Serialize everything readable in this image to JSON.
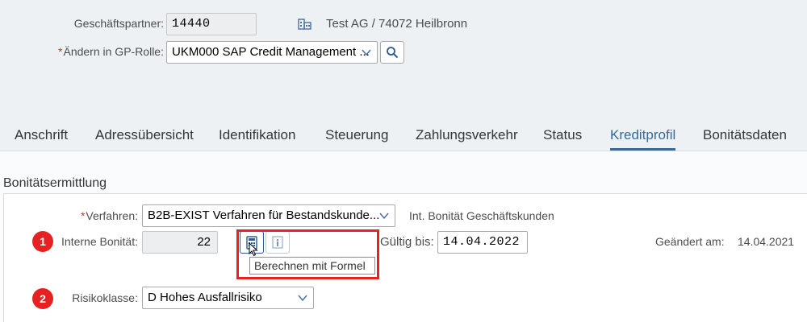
{
  "header": {
    "partner_label": "Geschäftspartner:",
    "partner_value": "14440",
    "partner_icon": "company-icon",
    "partner_name": "Test AG / 74072 Heilbronn",
    "role_required_mark": "*",
    "role_label": "Ändern in GP-Rolle:",
    "role_value": "UKM000 SAP Credit Management ...",
    "role_search_icon": "search-icon"
  },
  "tabs": [
    {
      "label": "Anschrift",
      "active": false
    },
    {
      "label": "Adressübersicht",
      "active": false
    },
    {
      "label": "Identifikation",
      "active": false
    },
    {
      "label": "Steuerung",
      "active": false
    },
    {
      "label": "Zahlungsverkehr",
      "active": false
    },
    {
      "label": "Status",
      "active": false
    },
    {
      "label": "Kreditprofil",
      "active": true
    },
    {
      "label": "Bonitätsdaten",
      "active": false
    }
  ],
  "section": {
    "title": "Bonitätsermittlung",
    "verfahren_required_mark": "*",
    "verfahren_label": "Verfahren:",
    "verfahren_value": "B2B-EXIST Verfahren für Bestandskunde...",
    "verfahren_desc": "Int. Bonität Geschäftskunden",
    "bonitaet_label": "Interne Bonität:",
    "bonitaet_value": "22",
    "calc_icon": "calculator-icon",
    "info_icon": "info-icon",
    "tooltip": "Berechnen mit Formel",
    "gueltig_label": "Gültig bis:",
    "gueltig_value": "14.04.2022",
    "geaendert_label": "Geändert am:",
    "geaendert_value": "14.04.2021",
    "risiko_label": "Risikoklasse:",
    "risiko_value": "D Hohes Ausfallrisiko"
  },
  "annotations": {
    "marker_1": "1",
    "marker_2": "2",
    "marker_color": "#e52121"
  },
  "colors": {
    "accent": "#366a97",
    "background": "#eef1f4"
  }
}
